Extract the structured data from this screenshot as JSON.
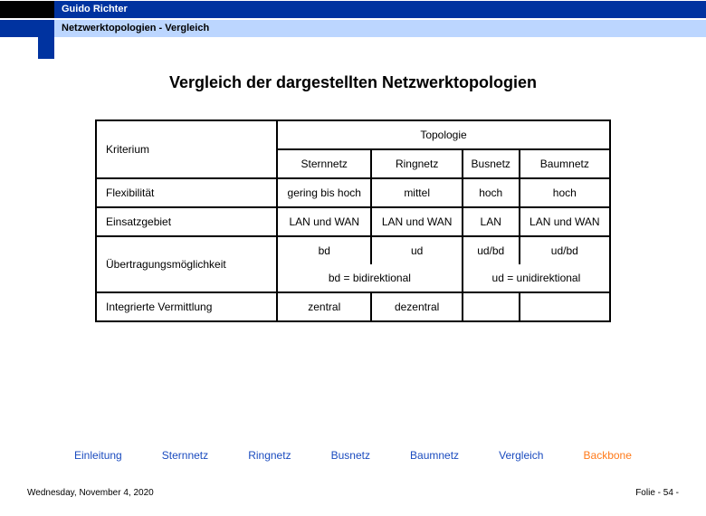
{
  "header": {
    "author": "Guido Richter",
    "subtitle": "Netzwerktopologien  - Vergleich"
  },
  "title": "Vergleich der dargestellten Netzwerktopologien",
  "table": {
    "kriterium_label": "Kriterium",
    "topologie_label": "Topologie",
    "cols": [
      "Sternnetz",
      "Ringnetz",
      "Busnetz",
      "Baumnetz"
    ],
    "row_flex_label": "Flexibilität",
    "row_flex": [
      "gering bis hoch",
      "mittel",
      "hoch",
      "hoch"
    ],
    "row_einsatz_label": "Einsatzgebiet",
    "row_einsatz": [
      "LAN und WAN",
      "LAN und WAN",
      "LAN",
      "LAN und WAN"
    ],
    "row_uebtr_label": "Übertragungsmöglichkeit",
    "row_uebtr_abbr": [
      "bd",
      "ud",
      "ud/bd",
      "ud/bd"
    ],
    "legend_bd": "bd = bidirektional",
    "legend_ud": "ud = unidirektional",
    "row_integ_label": "Integrierte Vermittlung",
    "row_integ": [
      "zentral",
      "dezentral",
      "",
      ""
    ]
  },
  "nav": {
    "items": [
      "Einleitung",
      "Sternnetz",
      "Ringnetz",
      "Busnetz",
      "Baumnetz",
      "Vergleich",
      "Backbone"
    ]
  },
  "footer": {
    "date": "Wednesday, November 4, 2020",
    "page": "Folie - 54 -"
  }
}
